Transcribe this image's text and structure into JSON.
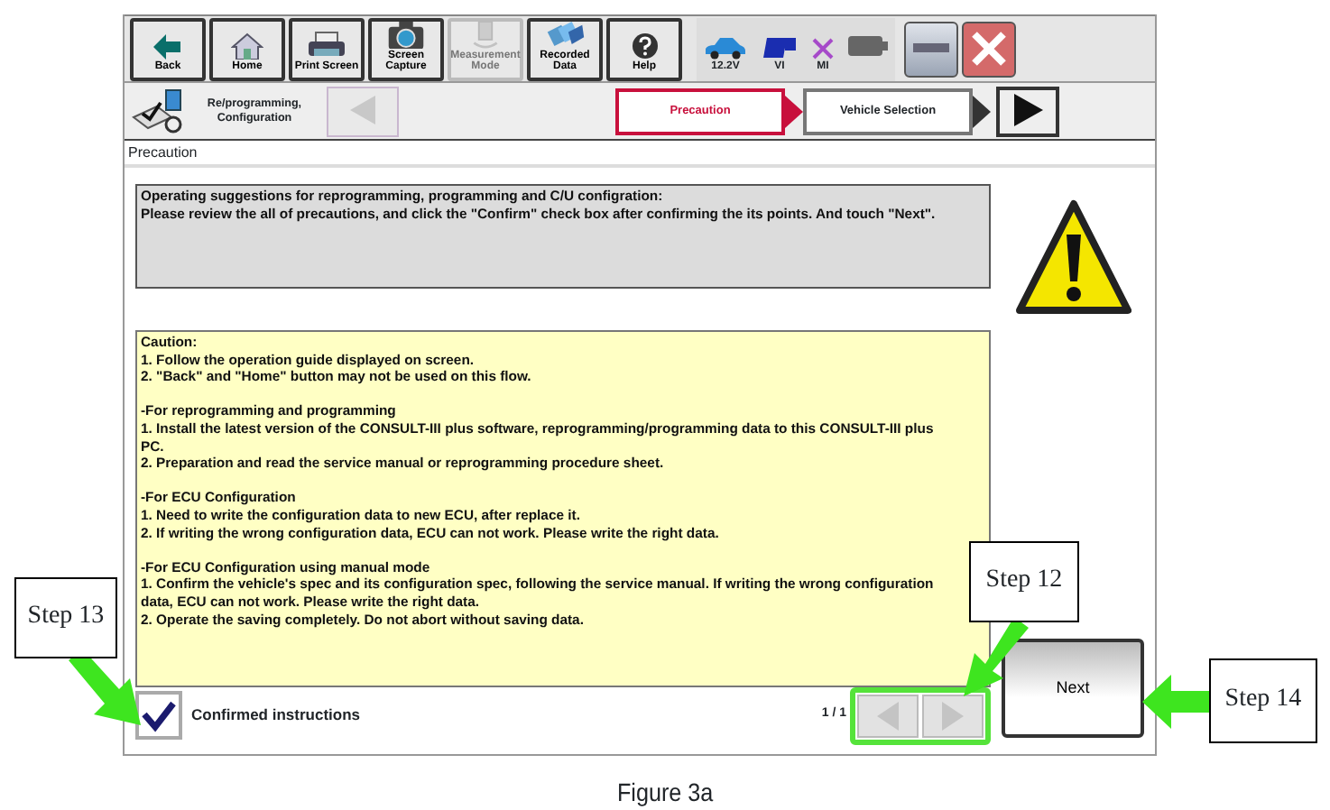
{
  "toolbar": [
    {
      "label": "Back",
      "disabled": false
    },
    {
      "label": "Home",
      "disabled": false
    },
    {
      "label": "Print Screen",
      "disabled": false
    },
    {
      "label": "Screen Capture",
      "disabled": false
    },
    {
      "label": "Measurement Mode",
      "disabled": true
    },
    {
      "label": "Recorded Data",
      "disabled": false
    },
    {
      "label": "Help",
      "disabled": false
    }
  ],
  "status": [
    "12.2V",
    "VI",
    "MI"
  ],
  "breadcrumb": {
    "title": "Re/programming, Configuration",
    "back_disabled": true,
    "steps": [
      {
        "label": "Precaution",
        "selected": true
      },
      {
        "label": "Vehicle Selection",
        "selected": false
      }
    ]
  },
  "section_title": "Precaution",
  "instructions": [
    "Operating suggestions for reprogramming, programming and C/U configration:",
    "Please review the all of precautions, and click the \"Confirm\" check box after confirming the its points. And touch \"Next\"."
  ],
  "caution": [
    {
      "lines": [
        "Caution:",
        "1. Follow the operation guide displayed on screen.",
        "2. \"Back\" and  \"Home\" button may not be used on this flow."
      ]
    },
    {
      "lines": [
        "-For reprogramming and programming",
        "1. Install the latest version of the CONSULT-III plus software, reprogramming/programming data to this CONSULT-III plus PC.",
        "2. Preparation and read the service manual or reprogramming procedure sheet."
      ]
    },
    {
      "lines": [
        "-For ECU Configuration",
        "1. Need to write the configuration data to new ECU, after replace it.",
        "2. If writing the wrong configuration data, ECU can not work. Please write the right data."
      ]
    },
    {
      "lines": [
        "-For ECU Configuration using manual mode",
        "1. Confirm the vehicle's spec and its configuration spec, following the service manual.  If writing the wrong configuration data, ECU can not work. Please write the right data.",
        "2. Operate the saving completely. Do not abort without saving data."
      ]
    }
  ],
  "confirm": {
    "label": "Confirmed instructions",
    "checked": true
  },
  "page_indicator": "1 / 1",
  "next_button": "Next",
  "callouts": [
    "Step 13",
    "Step 12",
    "Step 14"
  ],
  "caption": "Figure 3a"
}
